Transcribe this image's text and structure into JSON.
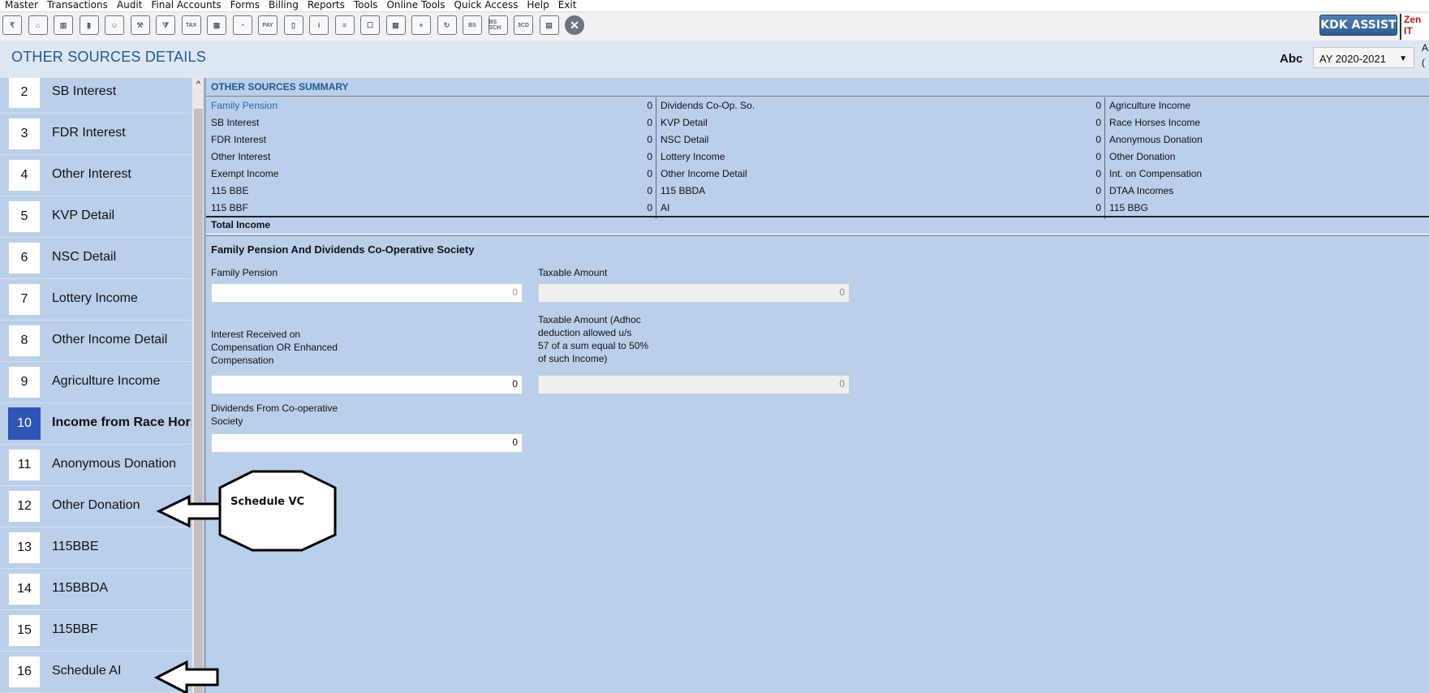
{
  "menu": [
    "Master",
    "Transactions",
    "Audit",
    "Final Accounts",
    "Forms",
    "Billing",
    "Reports",
    "Tools",
    "Online Tools",
    "Quick Access",
    "Help",
    "Exit"
  ],
  "toolbar": {
    "icons": [
      "rupee-doc-icon",
      "home-icon",
      "building-icon",
      "bar-chart-icon",
      "people-icon",
      "hammer-icon",
      "filter-icon",
      "tax-calc-icon",
      "calculator-icon",
      "pie-chart-icon",
      "e-pay-icon",
      "book-icon",
      "info-icon",
      "report-icon",
      "document-user-icon",
      "calendar-icon",
      "folder-add-icon",
      "refresh-doc-icon",
      "balance-sheet-icon",
      "balance-sheet-sch-icon",
      "3cd-icon",
      "report-chart-icon",
      "close-icon"
    ],
    "icon_text": {
      "tax": "TAX",
      "pay": "PAY",
      "bs": "BS",
      "bs_sch": "BS SCH",
      "3cd": "3CD"
    },
    "kdk_assist": "KDK ASSIST",
    "zen": "Zen IT"
  },
  "header": {
    "title": "OTHER SOURCES DETAILS",
    "user": "Abc",
    "assessment_year": "AY 2020-2021",
    "extra": "A ("
  },
  "sidebar": {
    "items": [
      {
        "num": "2",
        "label": "SB Interest"
      },
      {
        "num": "3",
        "label": "FDR Interest"
      },
      {
        "num": "4",
        "label": "Other Interest"
      },
      {
        "num": "5",
        "label": "KVP Detail"
      },
      {
        "num": "6",
        "label": "NSC Detail"
      },
      {
        "num": "7",
        "label": "Lottery Income"
      },
      {
        "num": "8",
        "label": "Other Income Detail"
      },
      {
        "num": "9",
        "label": "Agriculture Income"
      },
      {
        "num": "10",
        "label": "Income from Race Horses",
        "active": true
      },
      {
        "num": "11",
        "label": "Anonymous Donation"
      },
      {
        "num": "12",
        "label": "Other Donation"
      },
      {
        "num": "13",
        "label": "115BBE"
      },
      {
        "num": "14",
        "label": "115BBDA"
      },
      {
        "num": "15",
        "label": "115BBF"
      },
      {
        "num": "16",
        "label": "Schedule AI"
      }
    ]
  },
  "summary": {
    "title": "OTHER SOURCES SUMMARY",
    "col1": [
      {
        "label": "Family Pension",
        "value": "0",
        "link": true
      },
      {
        "label": "SB Interest",
        "value": "0"
      },
      {
        "label": "FDR Interest",
        "value": "0"
      },
      {
        "label": "Other Interest",
        "value": "0"
      },
      {
        "label": "Exempt Income",
        "value": "0"
      },
      {
        "label": "115 BBE",
        "value": "0"
      },
      {
        "label": "115 BBF",
        "value": "0"
      }
    ],
    "col2": [
      {
        "label": "Dividends Co-Op. So.",
        "value": "0"
      },
      {
        "label": "KVP Detail",
        "value": "0"
      },
      {
        "label": "NSC Detail",
        "value": "0"
      },
      {
        "label": "Lottery Income",
        "value": "0"
      },
      {
        "label": "Other Income Detail",
        "value": "0"
      },
      {
        "label": "115 BBDA",
        "value": "0"
      },
      {
        "label": "AI",
        "value": "0"
      }
    ],
    "col3": [
      {
        "label": "Agriculture Income"
      },
      {
        "label": "Race Horses Income"
      },
      {
        "label": "Anonymous Donation"
      },
      {
        "label": "Other Donation"
      },
      {
        "label": "Int. on Compensation"
      },
      {
        "label": "DTAA Incomes"
      },
      {
        "label": "115 BBG"
      }
    ],
    "total_label": "Total Income"
  },
  "form": {
    "title": "Family Pension And Dividends Co-Operative Society",
    "family_pension_label": "Family Pension",
    "family_pension_value": "0",
    "taxable_amount_label": "Taxable Amount",
    "taxable_amount_value": "0",
    "interest_label": "Interest Received on\nCompensation OR Enhanced\nCompensation",
    "interest_value": "0",
    "taxable_adhoc_label": "Taxable Amount (Adhoc\ndeduction allowed u/s\n57 of a sum equal to 50%\nof such Income)",
    "taxable_adhoc_value": "0",
    "dividends_label": "Dividends From Co-operative\nSociety",
    "dividends_value": "0"
  },
  "annotations": {
    "schedule_vc": "Schedule VC"
  }
}
